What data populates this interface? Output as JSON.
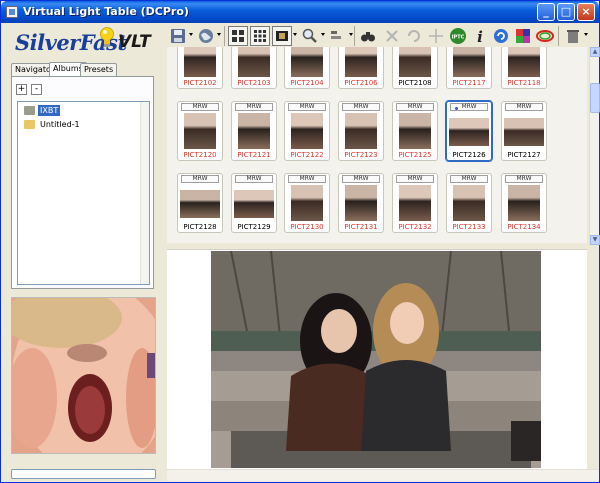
{
  "window": {
    "title": "Virtual Light Table (DCPro)",
    "minimize": "_",
    "maximize": "□",
    "close": "×"
  },
  "logo": {
    "brand": "SilverFast",
    "product": "VLT"
  },
  "tabs": [
    {
      "label": "Navigator",
      "active": false
    },
    {
      "label": "Albums",
      "active": true
    },
    {
      "label": "Presets",
      "active": false
    }
  ],
  "album_buttons": {
    "add": "+",
    "remove": "-"
  },
  "albums": [
    {
      "label": "IXBT",
      "selected": true
    },
    {
      "label": "Untitled-1",
      "selected": false
    }
  ],
  "toolbar_icons": [
    "save-icon",
    "globe-icon",
    "grid-large-icon",
    "grid-small-icon",
    "film-icon",
    "zoom-icon",
    "sort-icon",
    "binoculars-icon",
    "delete-x-icon",
    "rotate-icon",
    "transform-icon",
    "iptc-icon",
    "info-icon",
    "refresh-icon",
    "colors-icon",
    "rgb-icon",
    "trash-icon"
  ],
  "thumbnails": {
    "row1": [
      "PICT2102",
      "PICT2103",
      "PICT2104",
      "PICT2106",
      "PICT2108",
      "PICT2117",
      "PICT2118"
    ],
    "row1_colors": [
      "red",
      "red",
      "red",
      "red",
      "black",
      "red",
      "red"
    ],
    "row2": [
      "PICT2120",
      "PICT2121",
      "PICT2122",
      "PICT2123",
      "PICT2125",
      "PICT2126",
      "PICT2127"
    ],
    "row2_colors": [
      "red",
      "red",
      "red",
      "red",
      "red",
      "black",
      "black"
    ],
    "row3": [
      "PICT2128",
      "PICT2129",
      "PICT2130",
      "PICT2131",
      "PICT2132",
      "PICT2133",
      "PICT2134"
    ],
    "row3_colors": [
      "black",
      "black",
      "red",
      "red",
      "red",
      "red",
      "red"
    ],
    "format_label": "MRW",
    "selected": "PICT2126"
  }
}
